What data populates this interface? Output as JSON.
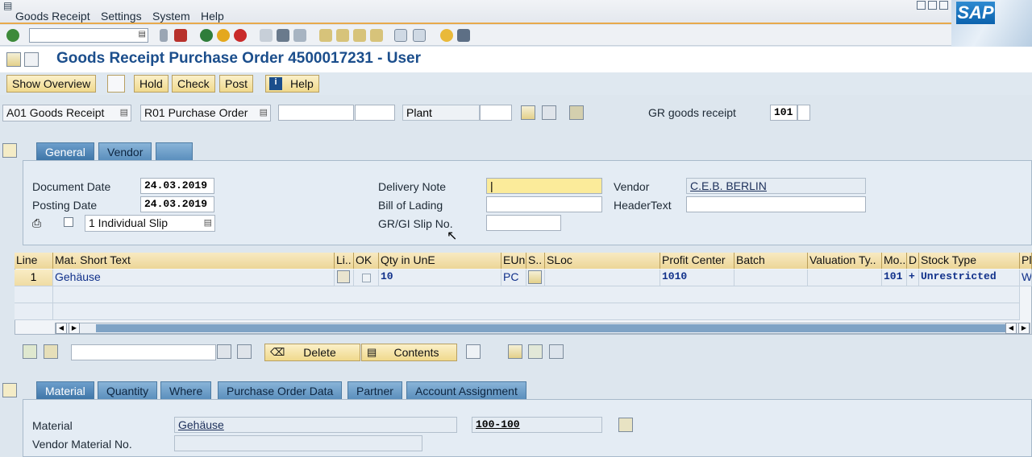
{
  "menu": {
    "items": [
      "Goods Receipt",
      "Settings",
      "System",
      "Help"
    ]
  },
  "brand": {
    "logo_text": "SAP",
    "accent": "#e8a94b"
  },
  "title": "Goods Receipt Purchase Order 4500017231 - User",
  "app_toolbar": {
    "show_overview": "Show Overview",
    "hold": "Hold",
    "check": "Check",
    "post": "Post",
    "help": "Help"
  },
  "header_row": {
    "transaction": "A01 Goods Receipt",
    "reference": "R01 Purchase Order",
    "plant_label": "Plant",
    "movement_label": "GR goods receipt",
    "movement_type": "101"
  },
  "header_tabs": [
    "General",
    "Vendor"
  ],
  "general": {
    "document_date_label": "Document Date",
    "document_date": "24.03.2019",
    "posting_date_label": "Posting Date",
    "posting_date": "24.03.2019",
    "slip_option": "1 Individual Slip",
    "delivery_note_label": "Delivery Note",
    "delivery_note": "|",
    "bill_of_lading_label": "Bill of Lading",
    "gr_slip_label": "GR/GI Slip No.",
    "vendor_label": "Vendor",
    "vendor": "C.E.B. BERLIN",
    "header_text_label": "HeaderText"
  },
  "grid": {
    "headers": [
      "Line",
      "Mat. Short Text",
      "Li..",
      "OK",
      "Qty in UnE",
      "EUn",
      "S..",
      "SLoc",
      "Profit Center",
      "Batch",
      "Valuation Ty..",
      "Mo..",
      "D",
      "Stock Type",
      "Pl"
    ],
    "row": {
      "line": "1",
      "text": "Gehäuse",
      "qty": "10",
      "unit": "PC",
      "profit_center": "1010",
      "movement": "101",
      "debit": "+",
      "stock_type": "Unrestricted",
      "plant": "W"
    }
  },
  "grid_toolbar": {
    "delete": "Delete",
    "contents": "Contents"
  },
  "detail_tabs": [
    "Material",
    "Quantity",
    "Where",
    "Purchase Order Data",
    "Partner",
    "Account Assignment"
  ],
  "material": {
    "material_label": "Material",
    "material_text": "Gehäuse",
    "material_number": "100-100",
    "vendor_material_label": "Vendor Material No."
  }
}
